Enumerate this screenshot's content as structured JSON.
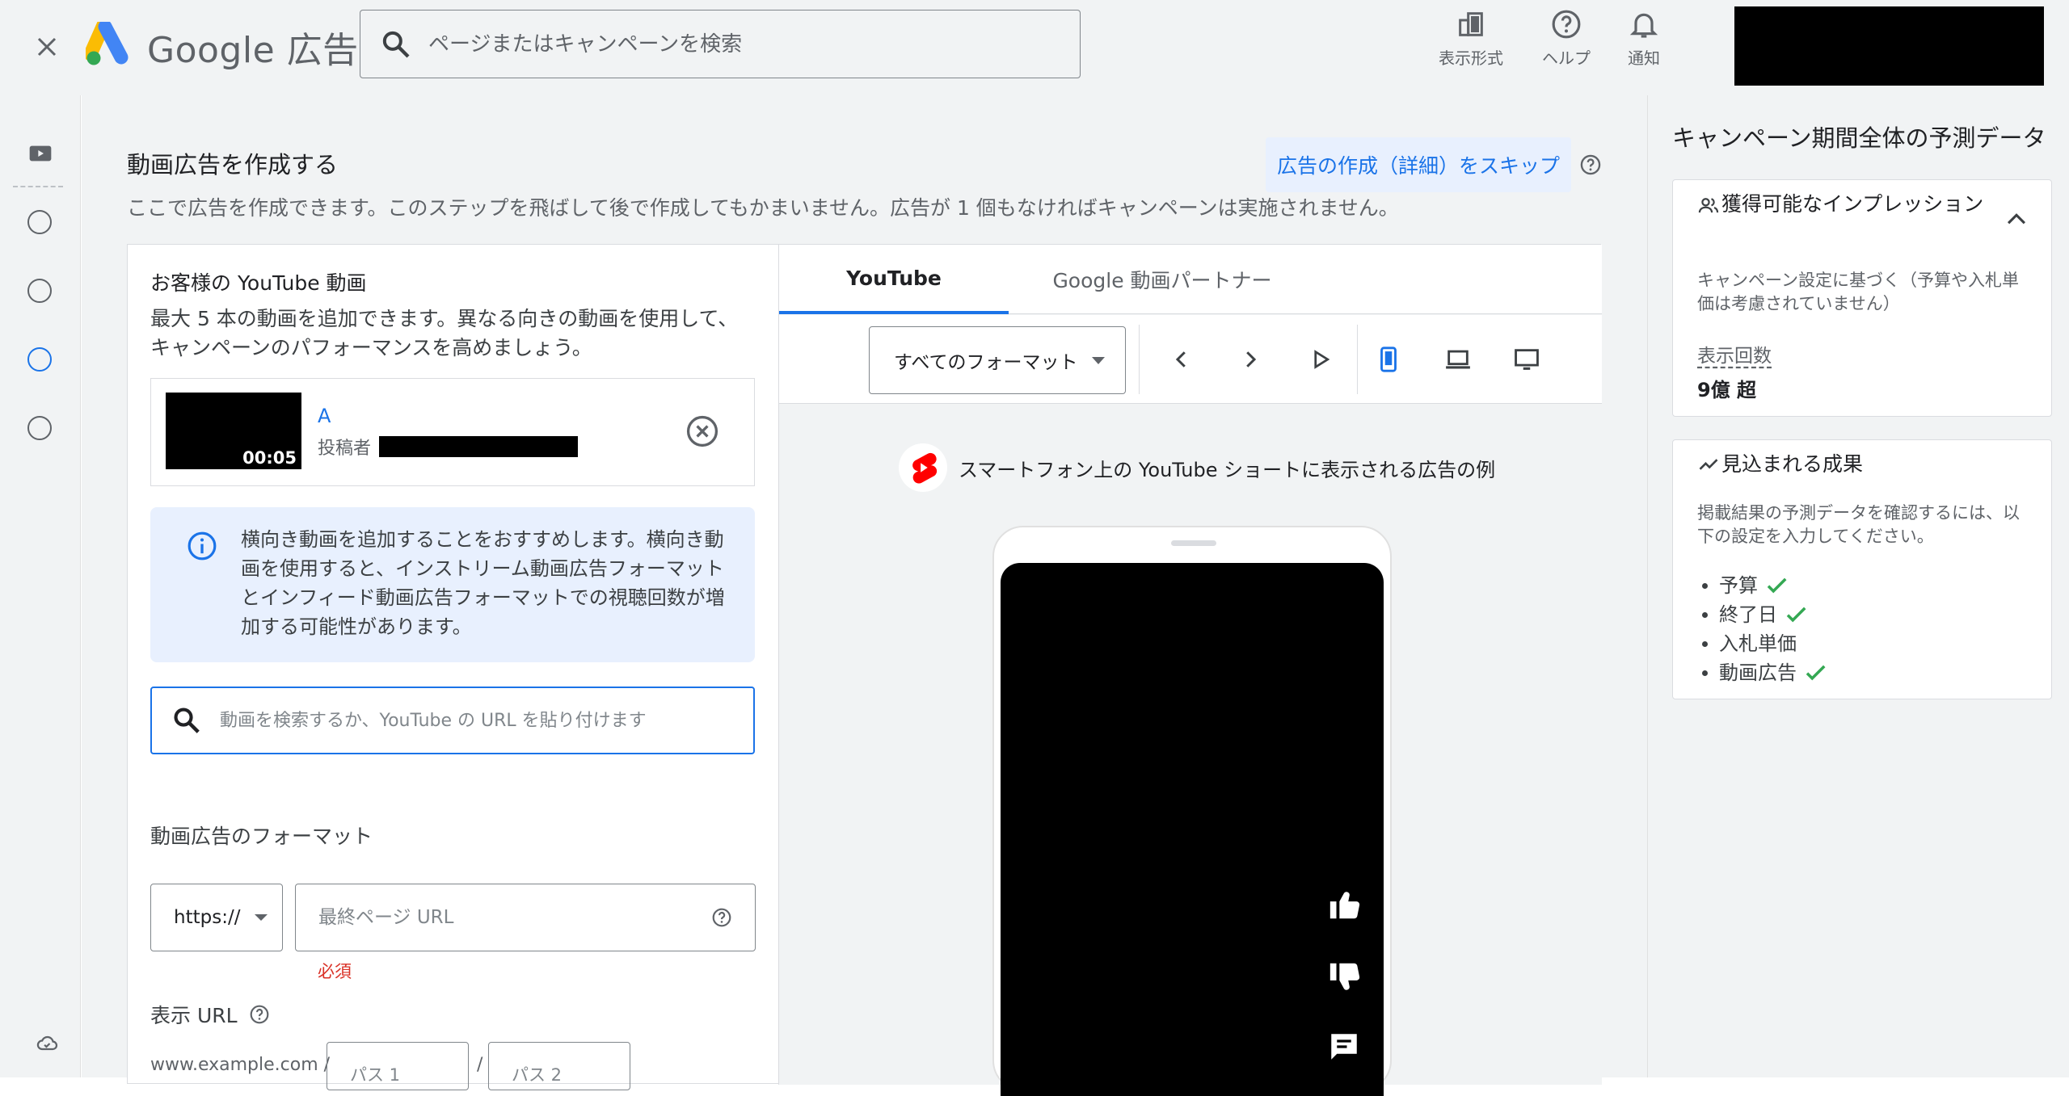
{
  "header": {
    "logo_text": "Google 広告",
    "search_placeholder": "ページまたはキャンペーンを検索",
    "icons": [
      {
        "label": "表示形式",
        "icon": "appearance-icon"
      },
      {
        "label": "ヘルプ",
        "icon": "help-icon"
      },
      {
        "label": "通知",
        "icon": "bell-icon"
      }
    ]
  },
  "main": {
    "title": "動画広告を作成する",
    "skip_link": "広告の作成（詳細）をスキップ",
    "description": "ここで広告を作成できます。このステップを飛ばして後で作成してもかまいません。広告が 1 個もなければキャンペーンは実施されません。",
    "videos_section": {
      "title": "お客様の YouTube 動画",
      "description": "最大 5 本の動画を追加できます。異なる向きの動画を使用して、キャンペーンのパフォーマンスを高めましょう。",
      "video": {
        "title": "A",
        "duration": "00:05",
        "author_label": "投稿者"
      },
      "info": "横向き動画を追加することをおすすめします。横向き動画を使用すると、インストリーム動画広告フォーマットとインフィード動画広告フォーマットでの視聴回数が増加する可能性があります。",
      "search_placeholder": "動画を検索するか、YouTube の URL を貼り付けます"
    },
    "format_label": "動画広告のフォーマット",
    "protocol": "https://",
    "final_url_placeholder": "最終ページ URL",
    "required": "必須",
    "display_url_label": "表示 URL",
    "display_url_prefix": "www.example.com /",
    "path1_placeholder": "パス 1",
    "path_separator": "/",
    "path2_placeholder": "パス 2"
  },
  "preview": {
    "tabs": [
      {
        "label": "YouTube",
        "active": true
      },
      {
        "label": "Google 動画パートナー",
        "active": false
      }
    ],
    "format_select": "すべてのフォーマット",
    "caption": "スマートフォン上の YouTube ショートに表示される広告の例"
  },
  "sidebar": {
    "title": "キャンペーン期間全体の予測データ",
    "impressions": {
      "title": "獲得可能なインプレッション",
      "subtitle": "キャンペーン設定に基づく（予算や入札単価は考慮されていません）",
      "metric": "表示回数",
      "value": "9億 超"
    },
    "results": {
      "title": "見込まれる成果",
      "description": "掲載結果の予測データを確認するには、以下の設定を入力してください。",
      "items": [
        {
          "label": "予算",
          "done": true
        },
        {
          "label": "終了日",
          "done": true
        },
        {
          "label": "入札単価",
          "done": false
        },
        {
          "label": "動画広告",
          "done": true
        }
      ]
    }
  },
  "colors": {
    "accent": "#1a73e8",
    "background": "#f1f3f4",
    "error": "#d93025",
    "success": "#34a853"
  }
}
